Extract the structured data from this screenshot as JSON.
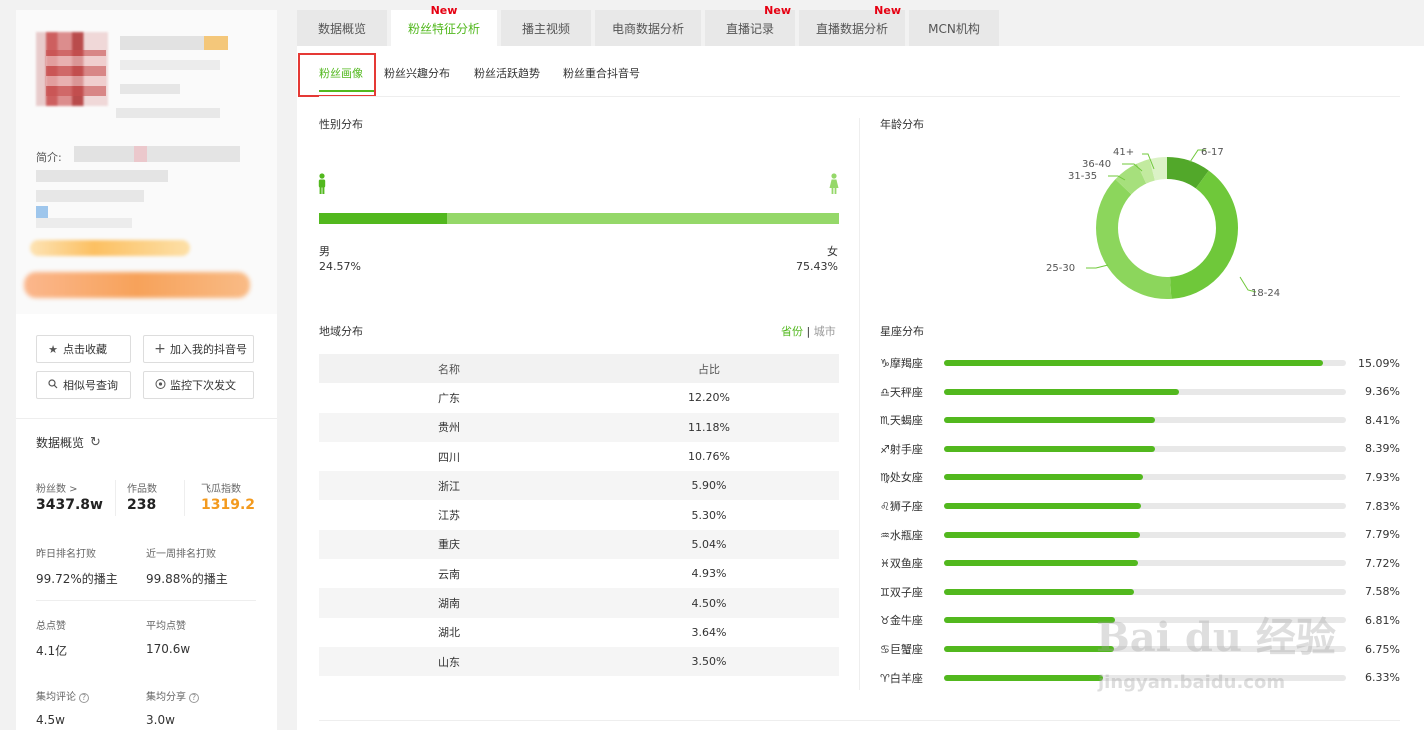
{
  "sidebar": {
    "intro_label": "简介:",
    "buttons": [
      {
        "label": "点击收藏",
        "icon": "star-icon"
      },
      {
        "label": "加入我的抖音号",
        "icon": "plus-icon"
      },
      {
        "label": "相似号查询",
        "icon": "search-icon"
      },
      {
        "label": "监控下次发文",
        "icon": "eye-icon"
      }
    ],
    "overview_title": "数据概览",
    "stats": {
      "fans_label": "粉丝数 >",
      "fans_value": "3437.8w",
      "works_label": "作品数",
      "works_value": "238",
      "index_label": "飞瓜指数",
      "index_value": "1319.2",
      "rank_yesterday_label": "昨日排名打败",
      "rank_yesterday_value": "99.72%的播主",
      "rank_week_label": "近一周排名打败",
      "rank_week_value": "99.88%的播主",
      "likes_total_label": "总点赞",
      "likes_total_value": "4.1亿",
      "likes_avg_label": "平均点赞",
      "likes_avg_value": "170.6w",
      "comments_label": "集均评论",
      "comments_value": "4.5w",
      "shares_label": "集均分享",
      "shares_value": "3.0w"
    }
  },
  "tabs": [
    {
      "label": "数据概览",
      "new": ""
    },
    {
      "label": "粉丝特征分析",
      "new": "New",
      "active": true
    },
    {
      "label": "播主视频",
      "new": ""
    },
    {
      "label": "电商数据分析",
      "new": ""
    },
    {
      "label": "直播记录",
      "new": "New"
    },
    {
      "label": "直播数据分析",
      "new": "New"
    },
    {
      "label": "MCN机构",
      "new": ""
    }
  ],
  "subtabs": [
    "粉丝画像",
    "粉丝兴趣分布",
    "粉丝活跃趋势",
    "粉丝重合抖音号"
  ],
  "gender": {
    "title": "性别分布",
    "male_label": "男",
    "male_pct": "24.57%",
    "male_value": 24.57,
    "female_label": "女",
    "female_pct": "75.43%",
    "colors": {
      "male": "#52b81e",
      "female": "#95d869"
    }
  },
  "region": {
    "title": "地域分布",
    "toggle_on": "省份",
    "toggle_sep": "|",
    "toggle_off": "城市",
    "col_name": "名称",
    "col_share": "占比",
    "rows": [
      {
        "name": "广东",
        "share": "12.20%"
      },
      {
        "name": "贵州",
        "share": "11.18%"
      },
      {
        "name": "四川",
        "share": "10.76%"
      },
      {
        "name": "浙江",
        "share": "5.90%"
      },
      {
        "name": "江苏",
        "share": "5.30%"
      },
      {
        "name": "重庆",
        "share": "5.04%"
      },
      {
        "name": "云南",
        "share": "4.93%"
      },
      {
        "name": "湖南",
        "share": "4.50%"
      },
      {
        "name": "湖北",
        "share": "3.64%"
      },
      {
        "name": "山东",
        "share": "3.50%"
      }
    ]
  },
  "age": {
    "title": "年龄分布",
    "labels": {
      "a": "6-17",
      "b": "18-24",
      "c": "25-30",
      "d": "31-35",
      "e": "36-40",
      "f": "41+"
    },
    "segments": [
      {
        "label": "6-17",
        "value": 10,
        "color": "#52a82a"
      },
      {
        "label": "18-24",
        "value": 39,
        "color": "#6fc83a"
      },
      {
        "label": "25-30",
        "value": 38,
        "color": "#8cd65c"
      },
      {
        "label": "31-35",
        "value": 6,
        "color": "#a6e07c"
      },
      {
        "label": "36-40",
        "value": 3,
        "color": "#c2ea9f"
      },
      {
        "label": "41+",
        "value": 4,
        "color": "#dbf2c6"
      }
    ]
  },
  "zodiac": {
    "title": "星座分布",
    "max": 16.0,
    "items": [
      {
        "name": "摩羯座",
        "glyph": "♑",
        "value": 15.09,
        "pct": "15.09%"
      },
      {
        "name": "天秤座",
        "glyph": "♎",
        "value": 9.36,
        "pct": "9.36%"
      },
      {
        "name": "天蝎座",
        "glyph": "♏",
        "value": 8.41,
        "pct": "8.41%"
      },
      {
        "name": "射手座",
        "glyph": "♐",
        "value": 8.39,
        "pct": "8.39%"
      },
      {
        "name": "处女座",
        "glyph": "♍",
        "value": 7.93,
        "pct": "7.93%"
      },
      {
        "name": "狮子座",
        "glyph": "♌",
        "value": 7.83,
        "pct": "7.83%"
      },
      {
        "name": "水瓶座",
        "glyph": "♒",
        "value": 7.79,
        "pct": "7.79%"
      },
      {
        "name": "双鱼座",
        "glyph": "♓",
        "value": 7.72,
        "pct": "7.72%"
      },
      {
        "name": "双子座",
        "glyph": "♊",
        "value": 7.58,
        "pct": "7.58%"
      },
      {
        "name": "金牛座",
        "glyph": "♉",
        "value": 6.81,
        "pct": "6.81%"
      },
      {
        "name": "巨蟹座",
        "glyph": "♋",
        "value": 6.75,
        "pct": "6.75%"
      },
      {
        "name": "白羊座",
        "glyph": "♈",
        "value": 6.33,
        "pct": "6.33%"
      }
    ],
    "bar_color": "#52b81e"
  },
  "watermark": {
    "logo": "Bai du 经验",
    "url": "jingyan.baidu.com"
  }
}
